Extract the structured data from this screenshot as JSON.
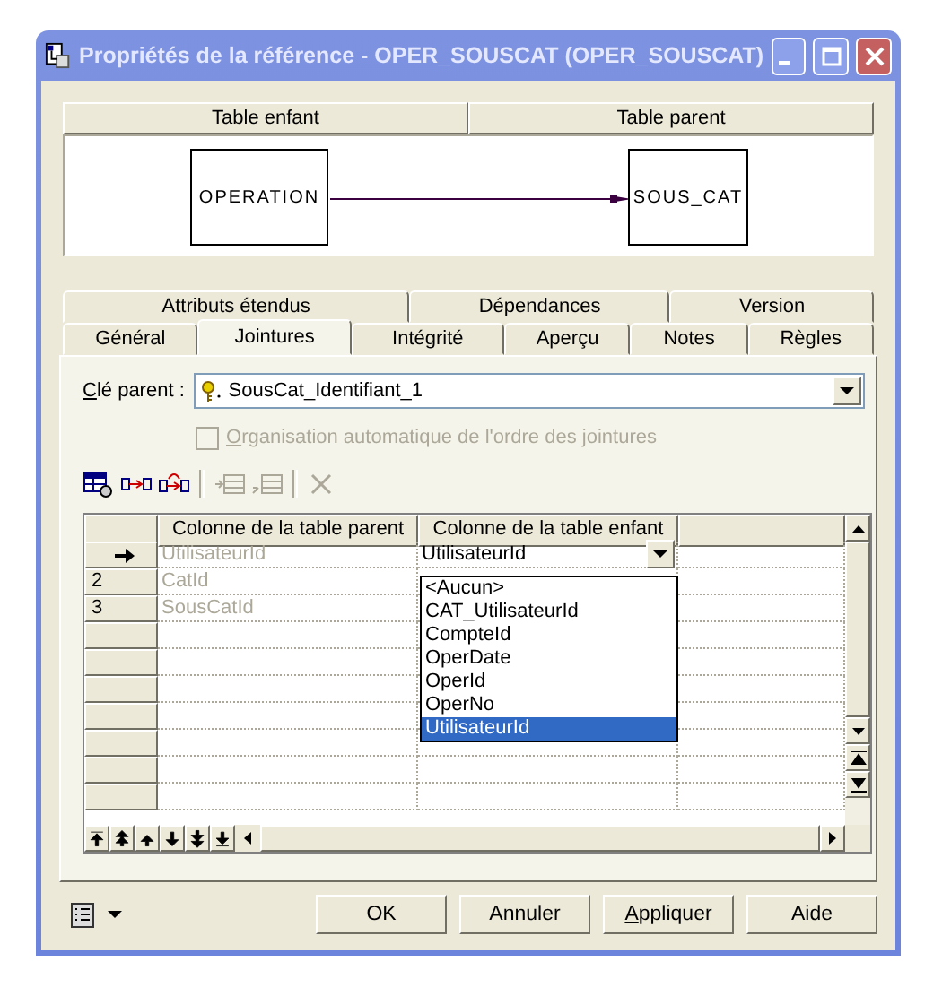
{
  "window": {
    "title": "Propriétés de la référence - OPER_SOUSCAT (OPER_SOUSCAT)"
  },
  "diagram": {
    "headers": [
      "Table enfant",
      "Table parent"
    ],
    "child": "OPERATION",
    "parent": "SOUS_CAT"
  },
  "tabs": [
    [
      {
        "label": "Attributs étendus",
        "selected": false
      },
      {
        "label": "Dépendances",
        "selected": false
      },
      {
        "label": "Version",
        "selected": false
      }
    ],
    [
      {
        "label": "Général",
        "selected": false
      },
      {
        "label": "Jointures",
        "selected": true
      },
      {
        "label": "Intégrité",
        "selected": false
      },
      {
        "label": "Aperçu",
        "selected": false
      },
      {
        "label": "Notes",
        "selected": false
      },
      {
        "label": "Règles",
        "selected": false
      }
    ]
  ],
  "parent_key": {
    "label": "Clé parent :",
    "mnemonic": true,
    "value": "SousCat_Identifiant_1"
  },
  "auto_order": {
    "label": "Organisation automatique de l'ordre des jointures",
    "mnemonic": true,
    "checked": false,
    "disabled": true
  },
  "toolbar": [
    {
      "kind": "properties",
      "disabled": false
    },
    {
      "kind": "link",
      "disabled": false
    },
    {
      "kind": "relink",
      "disabled": false
    },
    {
      "kind": "sep"
    },
    {
      "kind": "insert",
      "disabled": true
    },
    {
      "kind": "add",
      "disabled": true
    },
    {
      "kind": "sep"
    },
    {
      "kind": "delete",
      "disabled": true
    }
  ],
  "grid": {
    "columns": [
      "Colonne de la table parent",
      "Colonne de la table enfant"
    ],
    "rows": [
      {
        "current": true,
        "parent": "UtilisateurId",
        "child": "UtilisateurId"
      },
      {
        "current": false,
        "number": "2",
        "parent": "CatId"
      },
      {
        "current": false,
        "number": "3",
        "parent": "SousCatId"
      }
    ],
    "dropdown": [
      {
        "label": "<Aucun>",
        "selected": false
      },
      {
        "label": "CAT_UtilisateurId",
        "selected": false
      },
      {
        "label": "CompteId",
        "selected": false
      },
      {
        "label": "OperDate",
        "selected": false
      },
      {
        "label": "OperId",
        "selected": false
      },
      {
        "label": "OperNo",
        "selected": false
      },
      {
        "label": "UtilisateurId",
        "selected": true
      }
    ]
  },
  "buttons": [
    {
      "label": "OK",
      "mnemonic": false
    },
    {
      "label": "Annuler",
      "mnemonic": false
    },
    {
      "label": "Appliquer",
      "mnemonic": true
    },
    {
      "label": "Aide",
      "mnemonic": false
    }
  ]
}
